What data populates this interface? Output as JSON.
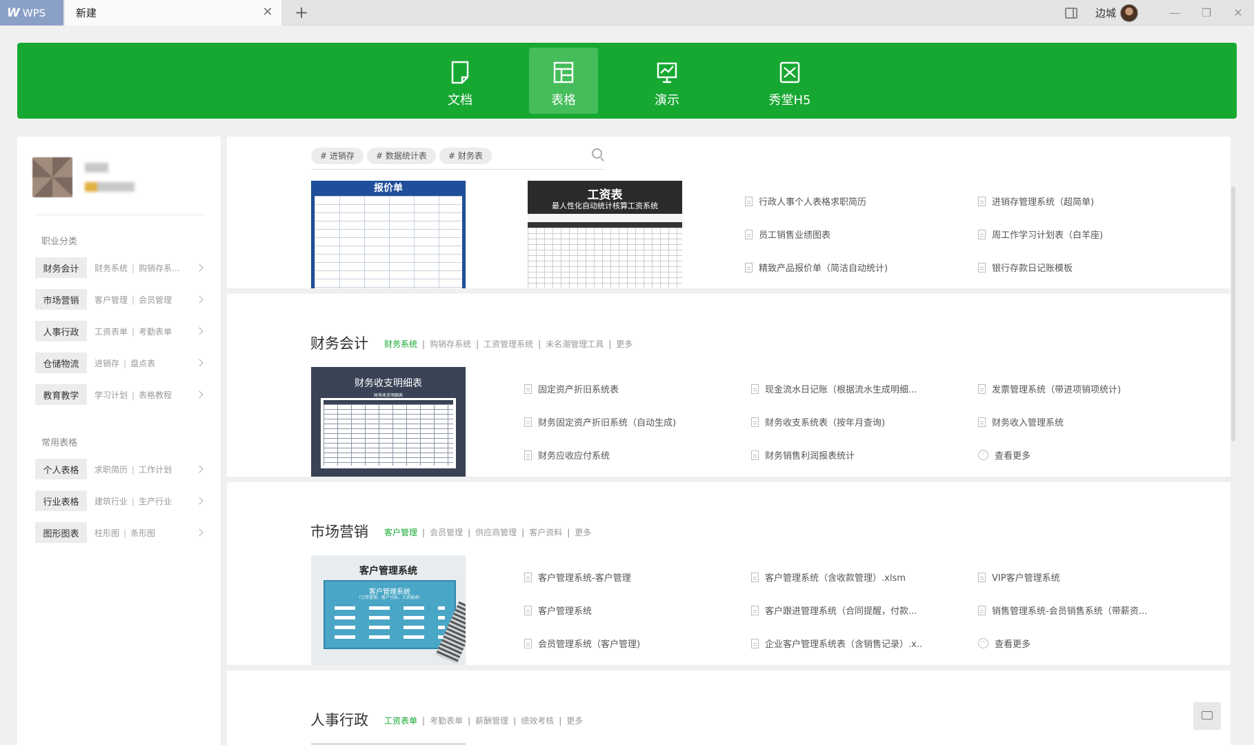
{
  "window": {
    "app_tab": "WPS",
    "doc_tab": "新建",
    "user_name": "边城"
  },
  "categories": [
    {
      "label": "文档",
      "icon": "document-icon"
    },
    {
      "label": "表格",
      "icon": "table-icon",
      "active": true
    },
    {
      "label": "演示",
      "icon": "presentation-icon"
    },
    {
      "label": "秀堂H5",
      "icon": "h5-icon"
    }
  ],
  "colors": {
    "brand": "#17a832",
    "active_tab": "#44bd5a",
    "accent_link": "#17a832"
  },
  "sidebar": {
    "section1": "职业分类",
    "section2": "常用表格",
    "rows": [
      {
        "tag": "财务会计",
        "a": "财务系统",
        "b": "购销存系..."
      },
      {
        "tag": "市场营销",
        "a": "客户管理",
        "b": "会员管理"
      },
      {
        "tag": "人事行政",
        "a": "工资表单",
        "b": "考勤表单"
      },
      {
        "tag": "仓储物流",
        "a": "进销存",
        "b": "盘点表"
      },
      {
        "tag": "教育教学",
        "a": "学习计划",
        "b": "表格教程"
      },
      {
        "tag": "个人表格",
        "a": "求职简历",
        "b": "工作计划"
      },
      {
        "tag": "行业表格",
        "a": "建筑行业",
        "b": "生产行业"
      },
      {
        "tag": "图形图表",
        "a": "柱形图",
        "b": "条形图"
      }
    ]
  },
  "search": {
    "tags": [
      "# 进销存",
      "# 数据统计表",
      "# 财务表"
    ]
  },
  "top_card": {
    "thumb1_title": "报价单",
    "thumb2_title": "工资表",
    "thumb2_sub": "最人性化自动统计核算工资系统",
    "items": [
      "行政人事个人表格求职简历",
      "进销存管理系统（超简单)",
      "员工销售业绩图表",
      "周工作学习计划表（白羊座)",
      "精致产品报价单（简洁自动统计)",
      "银行存款日记账模板"
    ]
  },
  "finance": {
    "title": "财务会计",
    "links": [
      "财务系统",
      "购销存系统",
      "工资管理系统",
      "未名潮管理工具",
      "更多"
    ],
    "thumb_title": "财务收支明细表",
    "thumb_sub": "财务收支明细表",
    "items": [
      "固定资产折旧系统表",
      "现金流水日记账（根据流水生成明细...",
      "发票管理系统（带进项销项统计)",
      "财务固定资产折旧系统（自动生成)",
      "财务收支系统表（按年月查询)",
      "财务收入管理系统",
      "财务应收应付系统",
      "财务销售利润报表统计",
      "查看更多"
    ]
  },
  "marketing": {
    "title": "市场营销",
    "links": [
      "客户管理",
      "会员管理",
      "供应商管理",
      "客户资料",
      "更多"
    ],
    "thumb_title": "客户管理系统",
    "thumb_sub": "客户管理系统",
    "thumb_sub2": "（订单管理，客户分析，工资报表）",
    "items": [
      "客户管理系统-客户管理",
      "客户管理系统（含收款管理）.xlsm",
      "VIP客户管理系统",
      "客户管理系统",
      "客户跟进管理系统（合同提醒，付款...",
      "销售管理系统-会员销售系统（带薪资...",
      "会员管理系统（客户管理)",
      "企业客户管理系统表（含销售记录）.x..",
      "查看更多"
    ]
  },
  "hr": {
    "title": "人事行政",
    "links": [
      "工资表单",
      "考勤表单",
      "薪酬管理",
      "绩效考核",
      "更多"
    ]
  }
}
